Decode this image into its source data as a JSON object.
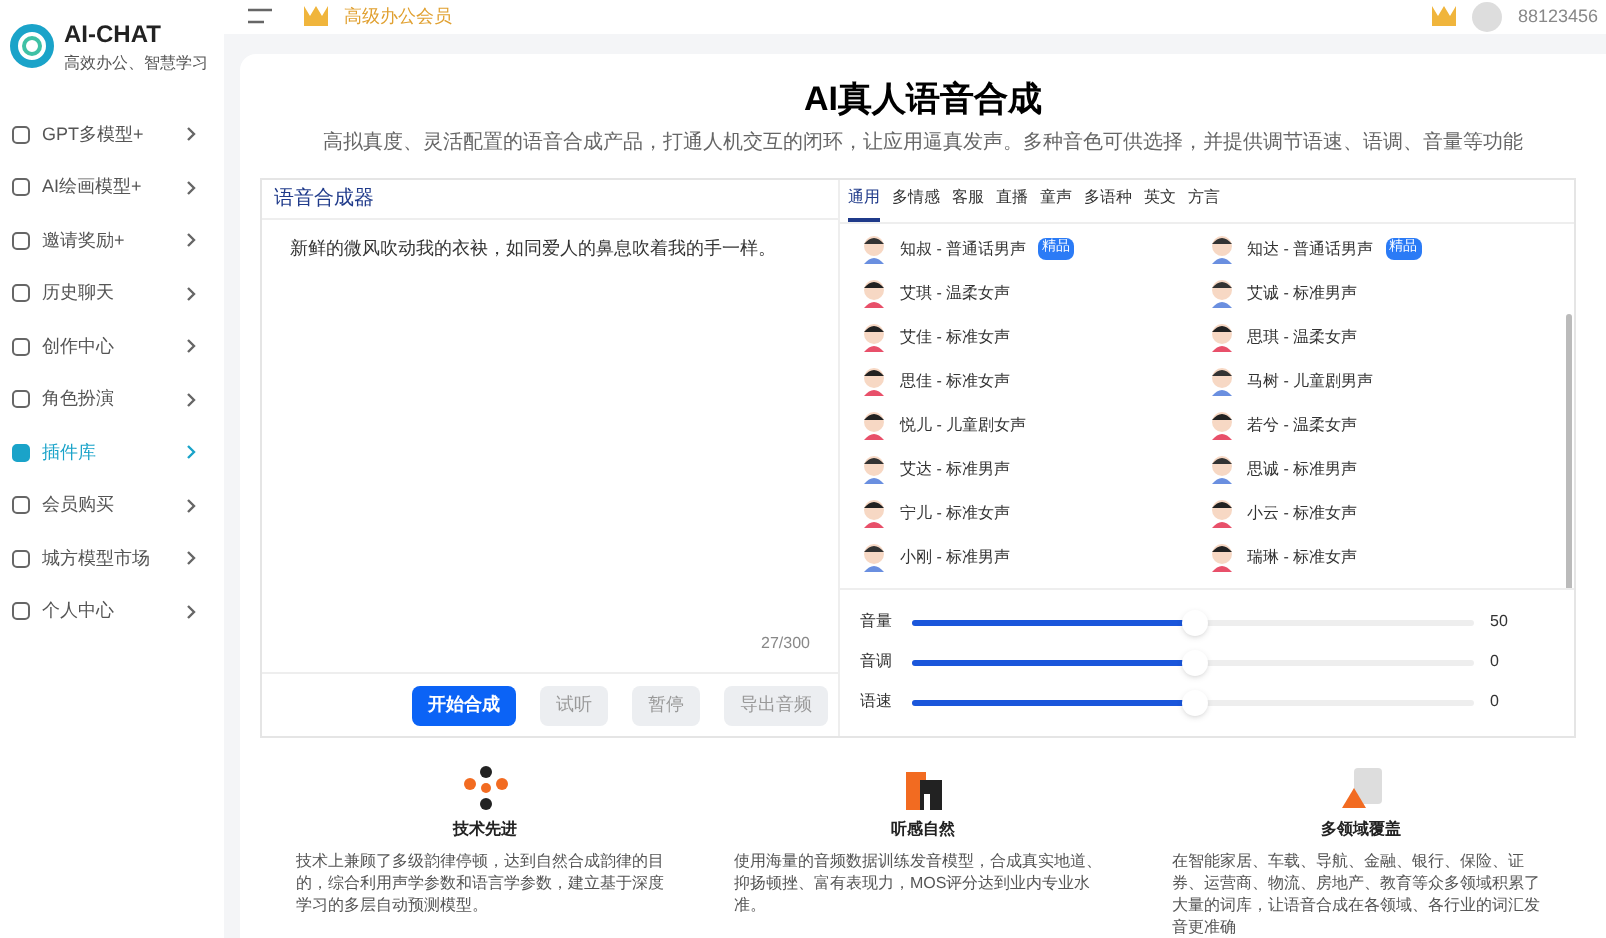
{
  "brand": {
    "name": "AI-CHAT",
    "tagline": "高效办公、智慧学习"
  },
  "sidebar": {
    "items": [
      {
        "label": "GPT多模型+",
        "selected": false
      },
      {
        "label": "AI绘画模型+",
        "selected": false
      },
      {
        "label": "邀请奖励+",
        "selected": false
      },
      {
        "label": "历史聊天",
        "selected": false
      },
      {
        "label": "创作中心",
        "selected": false
      },
      {
        "label": "角色扮演",
        "selected": false
      },
      {
        "label": "插件库",
        "selected": true
      },
      {
        "label": "会员购买",
        "selected": false
      },
      {
        "label": "城方模型市场",
        "selected": false
      },
      {
        "label": "个人中心",
        "selected": false
      }
    ]
  },
  "top_bar": {
    "membership": "高级办公会员",
    "username": "88123456"
  },
  "page": {
    "title": "AI真人语音合成",
    "subtitle": "高拟真度、灵活配置的语音合成产品，打通人机交互的闭环，让应用逼真发声。多种音色可供选择，并提供调节语速、语调、音量等功能"
  },
  "synth": {
    "title": "语音合成器",
    "text": "新鲜的微风吹动我的衣袂，如同爱人的鼻息吹着我的手一样。",
    "count": "27/300",
    "buttons": [
      {
        "label": "开始合成",
        "disabled": false
      },
      {
        "label": "试听",
        "disabled": true
      },
      {
        "label": "暂停",
        "disabled": true
      },
      {
        "label": "导出音频",
        "disabled": true
      }
    ]
  },
  "voice_tabs": [
    {
      "label": "通用",
      "selected": true
    },
    {
      "label": "多情感",
      "selected": false
    },
    {
      "label": "客服",
      "selected": false
    },
    {
      "label": "直播",
      "selected": false
    },
    {
      "label": "童声",
      "selected": false
    },
    {
      "label": "多语种",
      "selected": false
    },
    {
      "label": "英文",
      "selected": false
    },
    {
      "label": "方言",
      "selected": false
    }
  ],
  "voices": [
    {
      "name": "知叔 - 普通话男声",
      "kind": "male",
      "badge": "精品"
    },
    {
      "name": "知达 - 普通话男声",
      "kind": "male",
      "badge": "精品"
    },
    {
      "name": "艾琪 - 温柔女声",
      "kind": "female"
    },
    {
      "name": "艾诚 - 标准男声",
      "kind": "male"
    },
    {
      "name": "艾佳 - 标准女声",
      "kind": "female"
    },
    {
      "name": "思琪 - 温柔女声",
      "kind": "female"
    },
    {
      "name": "思佳 - 标准女声",
      "kind": "female"
    },
    {
      "name": "马树 - 儿童剧男声",
      "kind": "male"
    },
    {
      "name": "悦儿 - 儿童剧女声",
      "kind": "female"
    },
    {
      "name": "若兮 - 温柔女声",
      "kind": "female"
    },
    {
      "name": "艾达 - 标准男声",
      "kind": "male"
    },
    {
      "name": "思诚 - 标准男声",
      "kind": "male"
    },
    {
      "name": "宁儿 - 标准女声",
      "kind": "female"
    },
    {
      "name": "小云 - 标准女声",
      "kind": "female"
    },
    {
      "name": "小刚 - 标准男声",
      "kind": "male"
    },
    {
      "name": "瑞琳 - 标准女声",
      "kind": "female"
    }
  ],
  "sliders": [
    {
      "label": "音量",
      "level": 0.5,
      "reading": "50"
    },
    {
      "label": "音调",
      "level": 0.5,
      "reading": "0"
    },
    {
      "label": "语速",
      "level": 0.5,
      "reading": "0"
    }
  ],
  "features": [
    {
      "kind": "tech",
      "title": "技术先进",
      "text": "技术上兼顾了多级韵律停顿，达到自然合成韵律的目的，综合利用声学参数和语言学参数，建立基于深度学习的多层自动预测模型。"
    },
    {
      "kind": "natural",
      "title": "听感自然",
      "text": "使用海量的音频数据训练发音模型，合成真实地道、抑扬顿挫、富有表现力，MOS评分达到业内专业水准。"
    },
    {
      "kind": "coverage",
      "title": "多领域覆盖",
      "text": "在智能家居、车载、导航、金融、银行、保险、证券、运营商、物流、房地产、教育等众多领域积累了大量的词库，让语音合成在各领域、各行业的词汇发音更准确"
    }
  ]
}
